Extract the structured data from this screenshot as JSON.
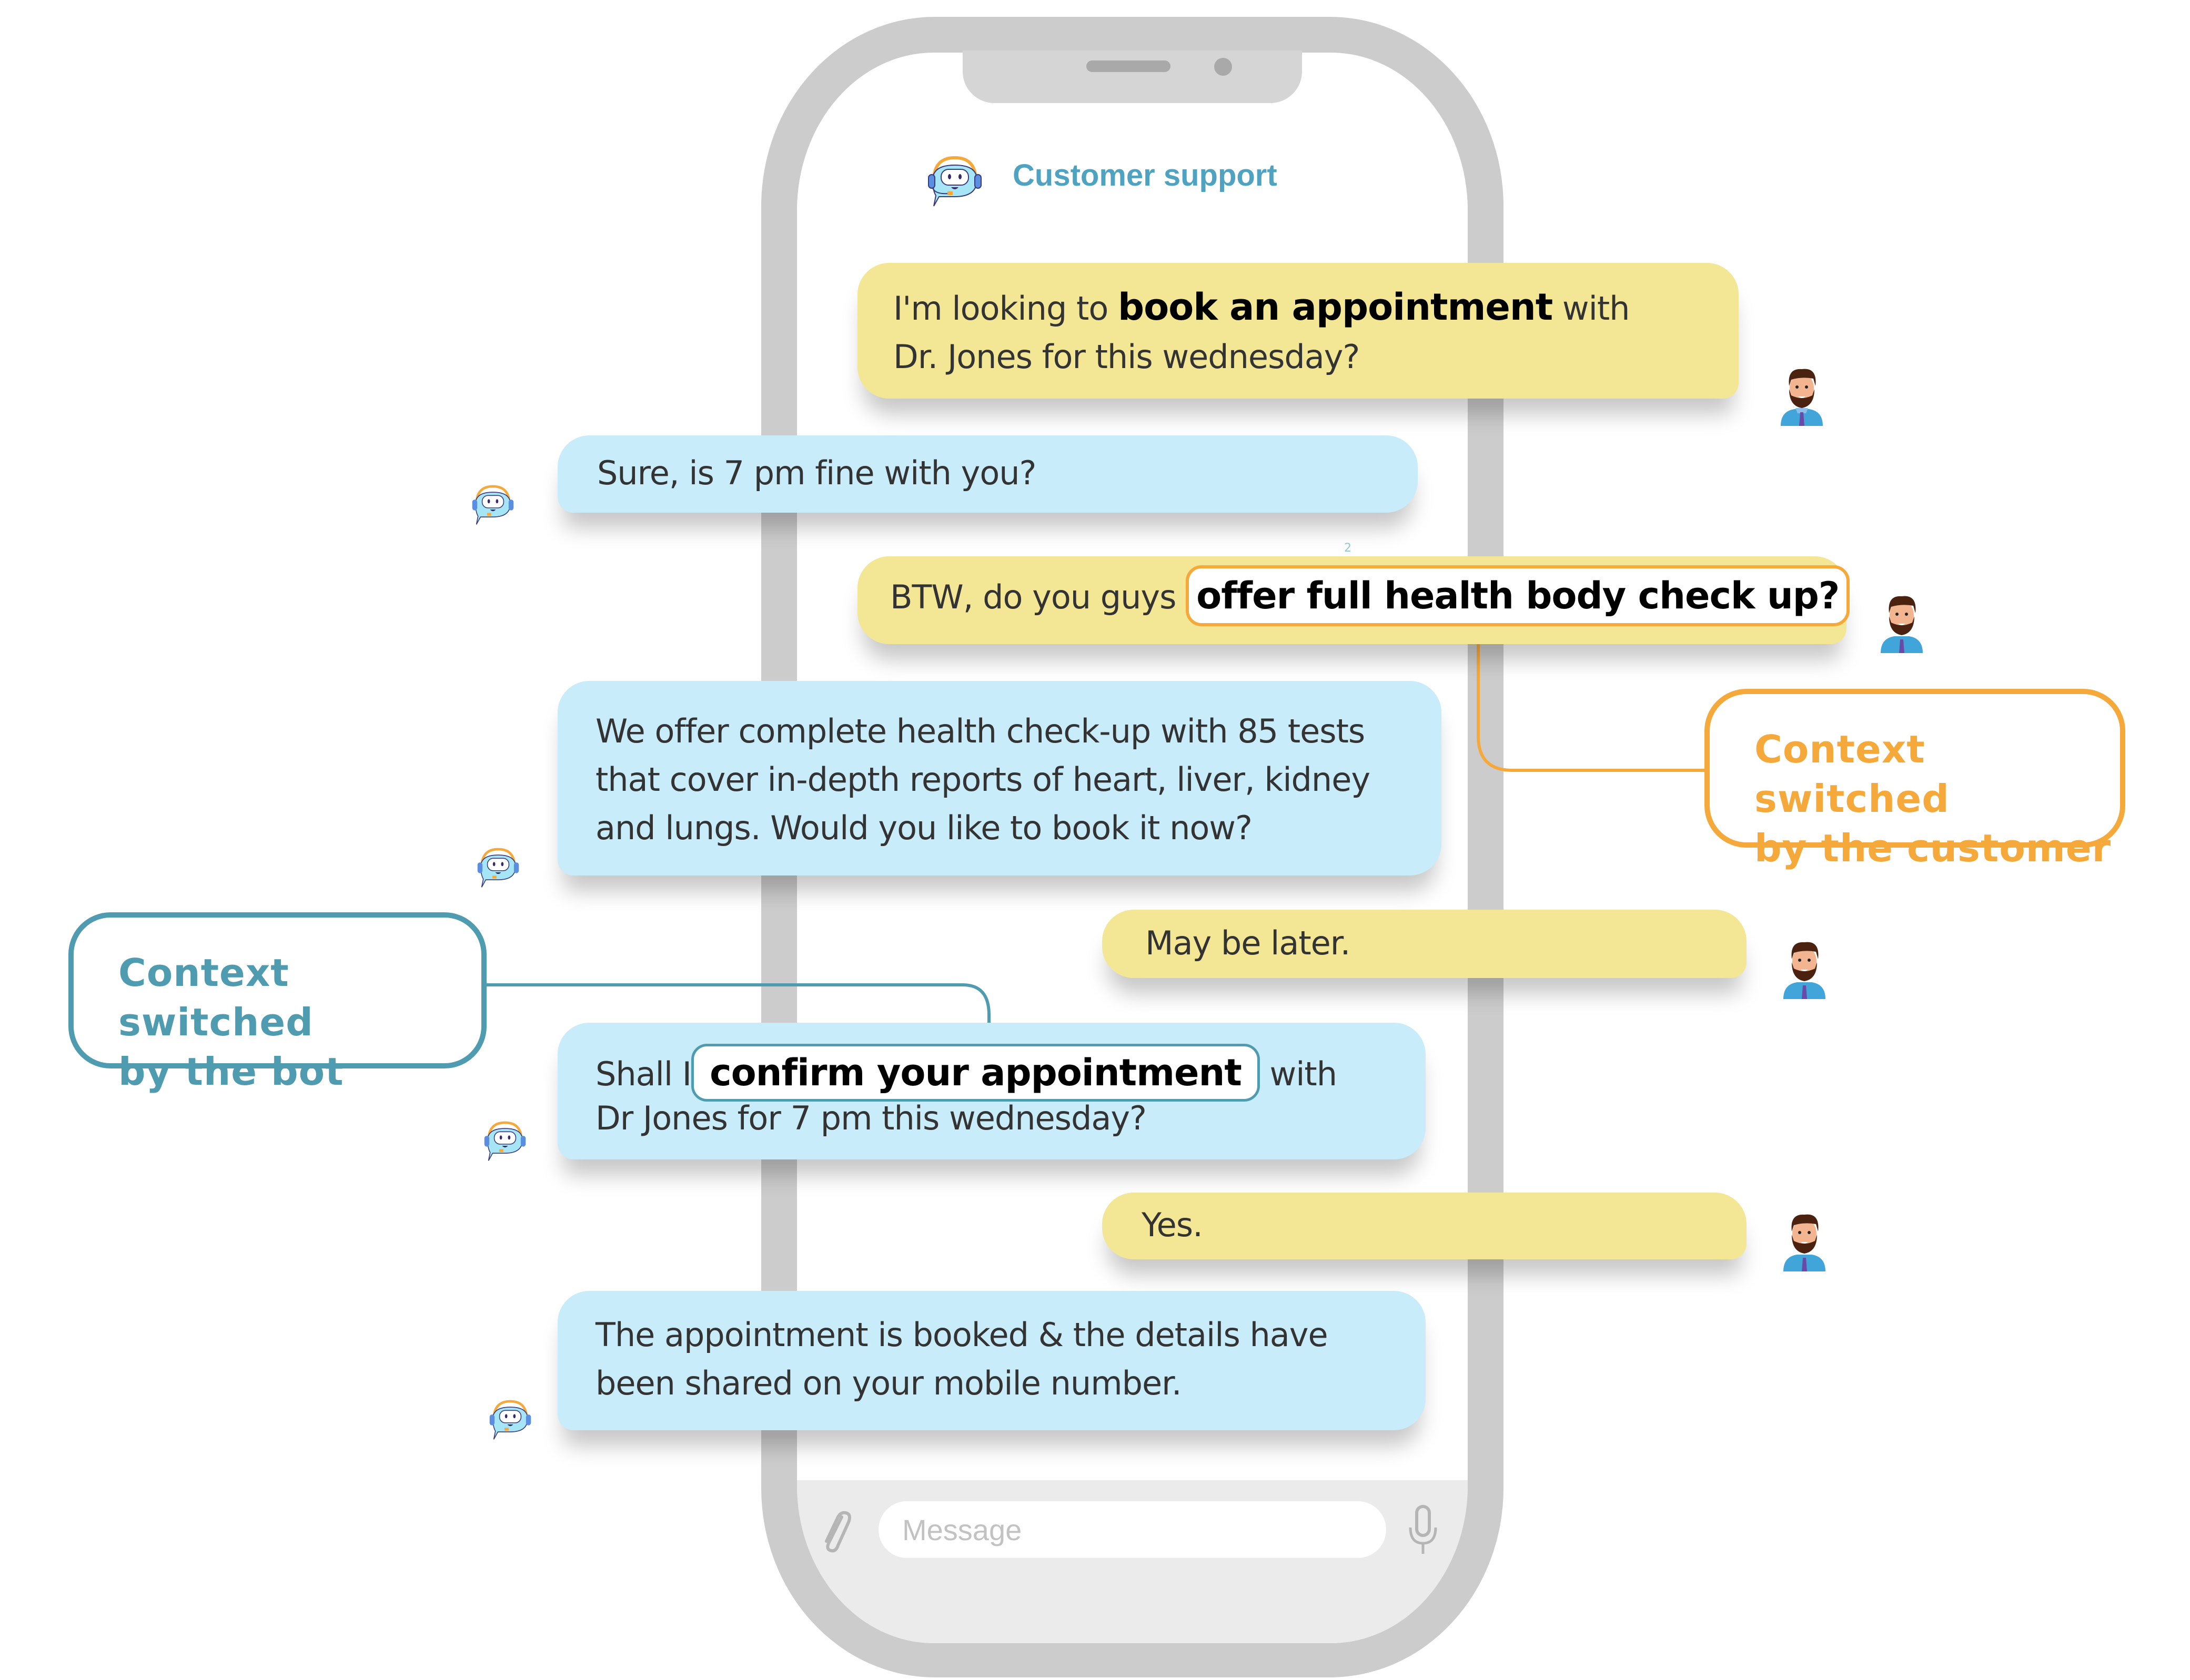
{
  "header": {
    "title": "Customer support",
    "icon": "bot-headset-icon"
  },
  "messages": [
    {
      "sender": "user",
      "parts": [
        {
          "text": "I'm looking to "
        },
        {
          "text": "book an appointment",
          "bold": true
        },
        {
          "text": " with"
        }
      ],
      "line2": "Dr. Jones for this wednesday?"
    },
    {
      "sender": "bot",
      "text": "Sure, is 7 pm fine with you?"
    },
    {
      "sender": "user",
      "prefix": "BTW, do you guys ",
      "highlight": "offer full health body check up?"
    },
    {
      "sender": "bot",
      "lines": [
        "We offer complete health check-up with 85 tests",
        "that cover in-depth reports of heart, liver, kidney",
        "and lungs. Would you like to book it now?"
      ]
    },
    {
      "sender": "user",
      "text": "May be later."
    },
    {
      "sender": "bot",
      "prefix": "Shall I",
      "highlight": "confirm your appointment",
      "suffix": " with",
      "line2": "Dr Jones for 7 pm this wednesday?"
    },
    {
      "sender": "user",
      "text": "Yes."
    },
    {
      "sender": "bot",
      "lines": [
        "The appointment is booked & the details have",
        "been shared on your mobile number."
      ]
    }
  ],
  "annotations": {
    "customer": {
      "line1": "Context switched",
      "line2": "by the customer",
      "color": "#f6a93b"
    },
    "bot": {
      "line1": "Context switched",
      "line2": "by the bot",
      "color": "#4f9bb0"
    },
    "marker": "2"
  },
  "composer": {
    "placeholder": "Message",
    "attach_icon": "paperclip-icon",
    "mic_icon": "microphone-icon"
  },
  "colors": {
    "user_bubble": "#f3e795",
    "bot_bubble": "#c9ecfb",
    "phone_frame": "#cccccc",
    "title": "#4fa3c0"
  }
}
